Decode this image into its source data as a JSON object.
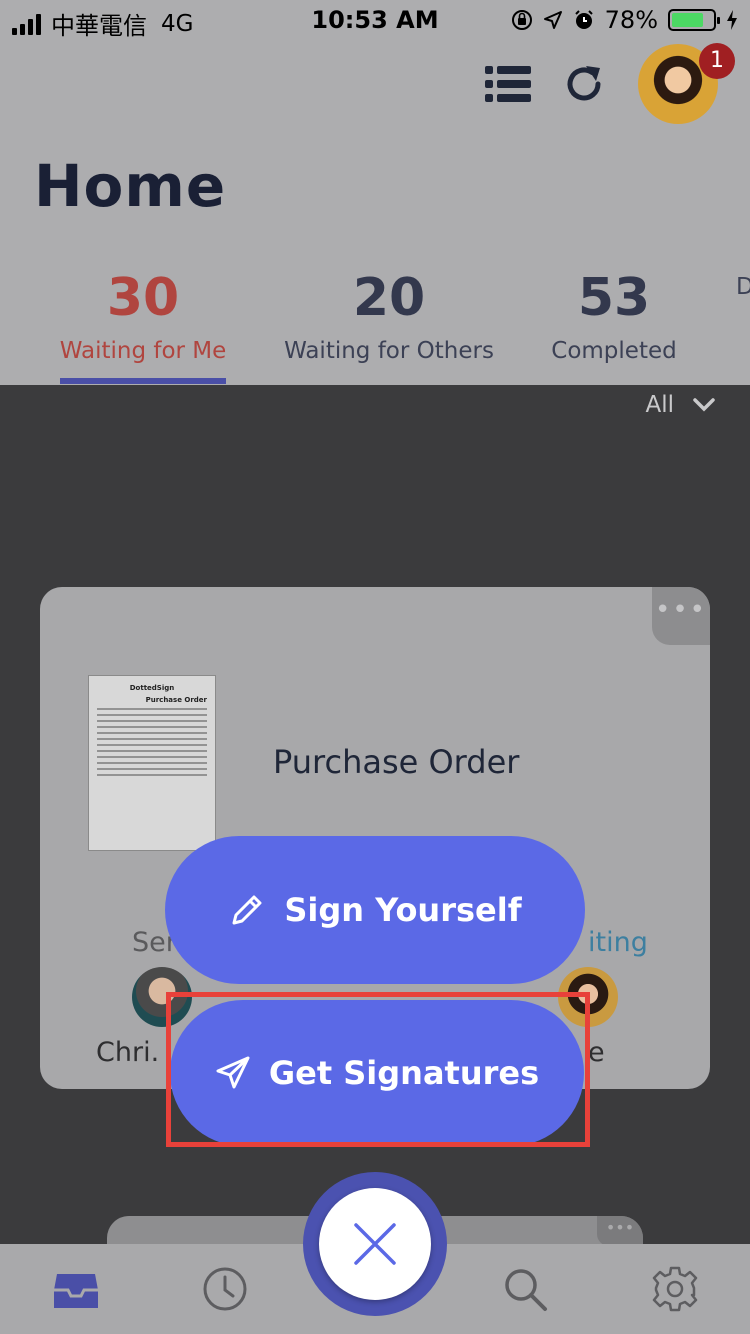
{
  "status_bar": {
    "carrier": "中華電信",
    "network": "4G",
    "time": "10:53 AM",
    "battery": "78%",
    "battery_level": 0.78
  },
  "header": {
    "title": "Home",
    "notification_count": "1",
    "icons": [
      "list-icon",
      "refresh-icon"
    ]
  },
  "tabs": [
    {
      "count": "30",
      "label": "Waiting for Me",
      "active": true
    },
    {
      "count": "20",
      "label": "Waiting for Others",
      "active": false
    },
    {
      "count": "53",
      "label": "Completed",
      "active": false
    },
    {
      "count": "",
      "label": "D",
      "active": false
    }
  ],
  "filter": {
    "label": "All"
  },
  "card": {
    "title": "Purchase Order",
    "thumbnail_brand": "DottedSign",
    "thumbnail_heading": "Purchase Order",
    "sender_label": "Ser",
    "status_label": "iting",
    "people": [
      {
        "name": "Chri."
      },
      {
        "name": "e"
      }
    ],
    "more_label": "•••"
  },
  "actions": {
    "sign_yourself": "Sign Yourself",
    "get_signatures": "Get Signatures"
  },
  "colors": {
    "accent": "#5b69e6",
    "active_tab": "#b0453f",
    "highlight": "#e8413a"
  },
  "tabbar": {
    "icons": [
      "inbox-icon",
      "clock-icon",
      "close-icon",
      "search-icon",
      "gear-icon"
    ]
  }
}
